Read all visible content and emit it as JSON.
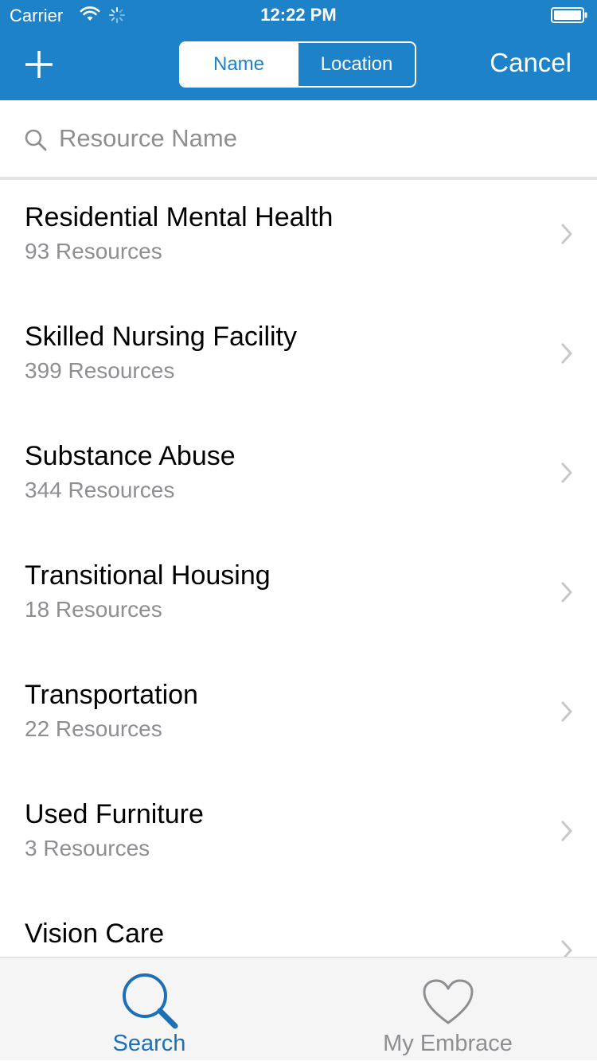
{
  "status_bar": {
    "carrier": "Carrier",
    "time": "12:22 PM",
    "icons": [
      "wifi-icon",
      "spinner-icon",
      "battery-icon"
    ]
  },
  "nav": {
    "add_icon": "plus-icon",
    "segments": [
      {
        "label": "Name",
        "selected": true
      },
      {
        "label": "Location",
        "selected": false
      }
    ],
    "cancel_label": "Cancel"
  },
  "search": {
    "placeholder": "Resource Name",
    "value": ""
  },
  "list": {
    "items": [
      {
        "title": "Residential Mental Health",
        "count": "93 Resources"
      },
      {
        "title": "Skilled Nursing Facility",
        "count": "399 Resources"
      },
      {
        "title": "Substance Abuse",
        "count": "344 Resources"
      },
      {
        "title": "Transitional Housing",
        "count": "18 Resources"
      },
      {
        "title": "Transportation",
        "count": "22 Resources"
      },
      {
        "title": "Used Furniture",
        "count": "3 Resources"
      },
      {
        "title": "Vision Care",
        "count": ""
      }
    ]
  },
  "tab_bar": {
    "tabs": [
      {
        "label": "Search",
        "icon": "search-icon",
        "selected": true
      },
      {
        "label": "My Embrace",
        "icon": "heart-icon",
        "selected": false
      }
    ]
  },
  "colors": {
    "brand": "#1e82c9",
    "selected_tab": "#1e6fb5",
    "secondary_text": "#8e8e93",
    "tab_bar_bg": "#f5f5f6"
  }
}
